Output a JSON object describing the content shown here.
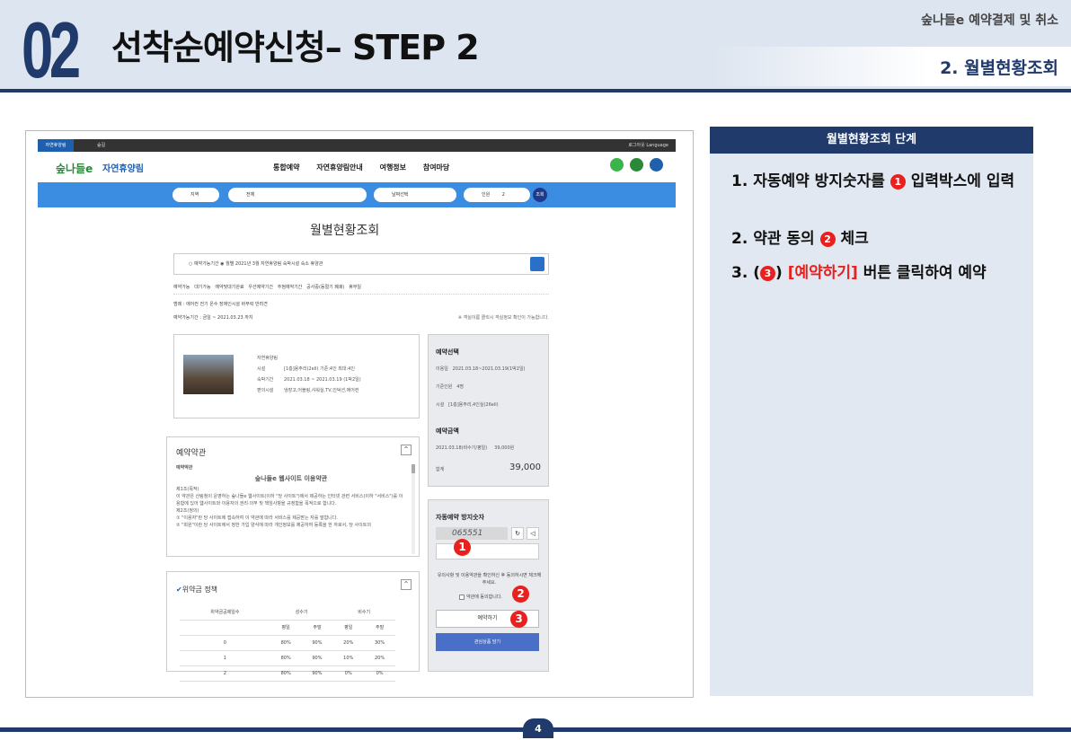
{
  "header": {
    "number": "02",
    "title": "선착순예약신청– STEP 2",
    "section": "숲나들e 예약결제 및 취소",
    "subtitle": "2. 월별현황조회"
  },
  "screenshot": {
    "topbar": {
      "tab": "자연휴양림",
      "tab2": "숲길",
      "right": "로그아웃  Language"
    },
    "nav": {
      "logo": "숲나들e",
      "brand": "자연휴양림",
      "menu": [
        "통합예약",
        "자연휴양림안내",
        "여행정보",
        "참여마당"
      ]
    },
    "search": {
      "region": "지역",
      "all": "전체",
      "date": "날짜선택",
      "persons": "인원",
      "count": "2",
      "go": "조회"
    },
    "page_title": "월별현황조회",
    "filter": "○ 예약가능기간  ◉ 월별   2021년 3월   자연휴양림   숙박시설  숙소   휴양관",
    "legend": [
      "예약가능",
      "대기가능",
      "예약및대기완료",
      "우선예약기간",
      "추첨예약기간",
      "공사중(동절기 폐쇄)",
      "휴무일"
    ],
    "legend2": "범례 : 에어컨  전기  온수  장애인시설  바무락  반려견",
    "avail": "예약가능기간 : 금일 ~ 2021.03.23 까지",
    "avail_note": "※ 객실이름 클릭시 객실정보 확인이 가능합니다.",
    "info": [
      {
        "label": "자연휴양림",
        "value": ""
      },
      {
        "label": "시설",
        "value": "[1층]용주리(2ell) 기준:4인 최대:4인"
      },
      {
        "label": "숙박기간",
        "value": "2021.03.18 ~ 2021.03.19 (1박2일)"
      },
      {
        "label": "편의시설",
        "value": "냉장고,어블링,샤워실,TV,인덕션,에어컨"
      }
    ],
    "reserve": {
      "title": "예약선택",
      "rows": [
        {
          "label": "이용일",
          "value": "2021.03.18~2021.03.19(1박2일)"
        },
        {
          "label": "기준인원",
          "value": "4명"
        },
        {
          "label": "시설",
          "value": "[1층]용주리,4인실(26ell)"
        }
      ],
      "amount_title": "예약금액",
      "amount_row": {
        "label": "2021.03.18(비수기/평일)",
        "value": "39,000원"
      },
      "total_label": "합계",
      "total": "39,000"
    },
    "terms": {
      "title": "예약약관",
      "sub": "예약약관",
      "heading": "숲나들e 웹사이트 이용약관",
      "body": [
        "제1조(목적)",
        "이 약관은 산림청이 운영하는 숲나들e 웹사이트(이하 \"당 사이트\")에서 제공하는 인터넷 관련 서비스(이하 \"서비스\")를 이용함에 있어 웹사이트와 이용자의 권리·의무 및 책임사항을 규정함을 목적으로 합니다.",
        "제2조(정의)",
        "① \"이용자\"란 당 사이트에 접속하여 이 약관에 따라 서비스를 제공받는 자를 말합니다.",
        "② \"회원\"이란 당 사이트에서 정한 가입 양식에 따라 개인정보를 제공하여 등록을 한 자로서, 당 사이트의"
      ]
    },
    "captcha": {
      "title": "자동예약 방지숫자",
      "code": "065551",
      "notice": "유의사항 및 이용약관을 확인하신 후 동의하시면 체크해주세요.",
      "agree": "약관에 동의합니다.",
      "reserve_btn": "예약하기",
      "wish_btn": "관심상품 담기"
    },
    "penalty": {
      "title": "위약금 정책",
      "headers": [
        "위약금공제일수",
        "성수기",
        "",
        "비수기",
        ""
      ],
      "sub": [
        "",
        "평일",
        "주말",
        "평일",
        "주말"
      ],
      "rows": [
        [
          "0",
          "80%",
          "90%",
          "20%",
          "30%"
        ],
        [
          "1",
          "80%",
          "90%",
          "10%",
          "20%"
        ],
        [
          "2",
          "80%",
          "90%",
          "0%",
          "0%"
        ]
      ]
    },
    "badges": [
      "1",
      "2",
      "3"
    ]
  },
  "panel": {
    "title": "월별현황조회 단계",
    "step1a": "1. 자동예약 방지숫자를",
    "step1b": "입력박스에 입력",
    "step2a": "2. 약관 동의",
    "step2b": "체크",
    "step3a": "3. (",
    "step3b": ")",
    "step3c": "[예약하기]",
    "step3d": "버튼 클릭하여 예약"
  },
  "page_number": "4"
}
